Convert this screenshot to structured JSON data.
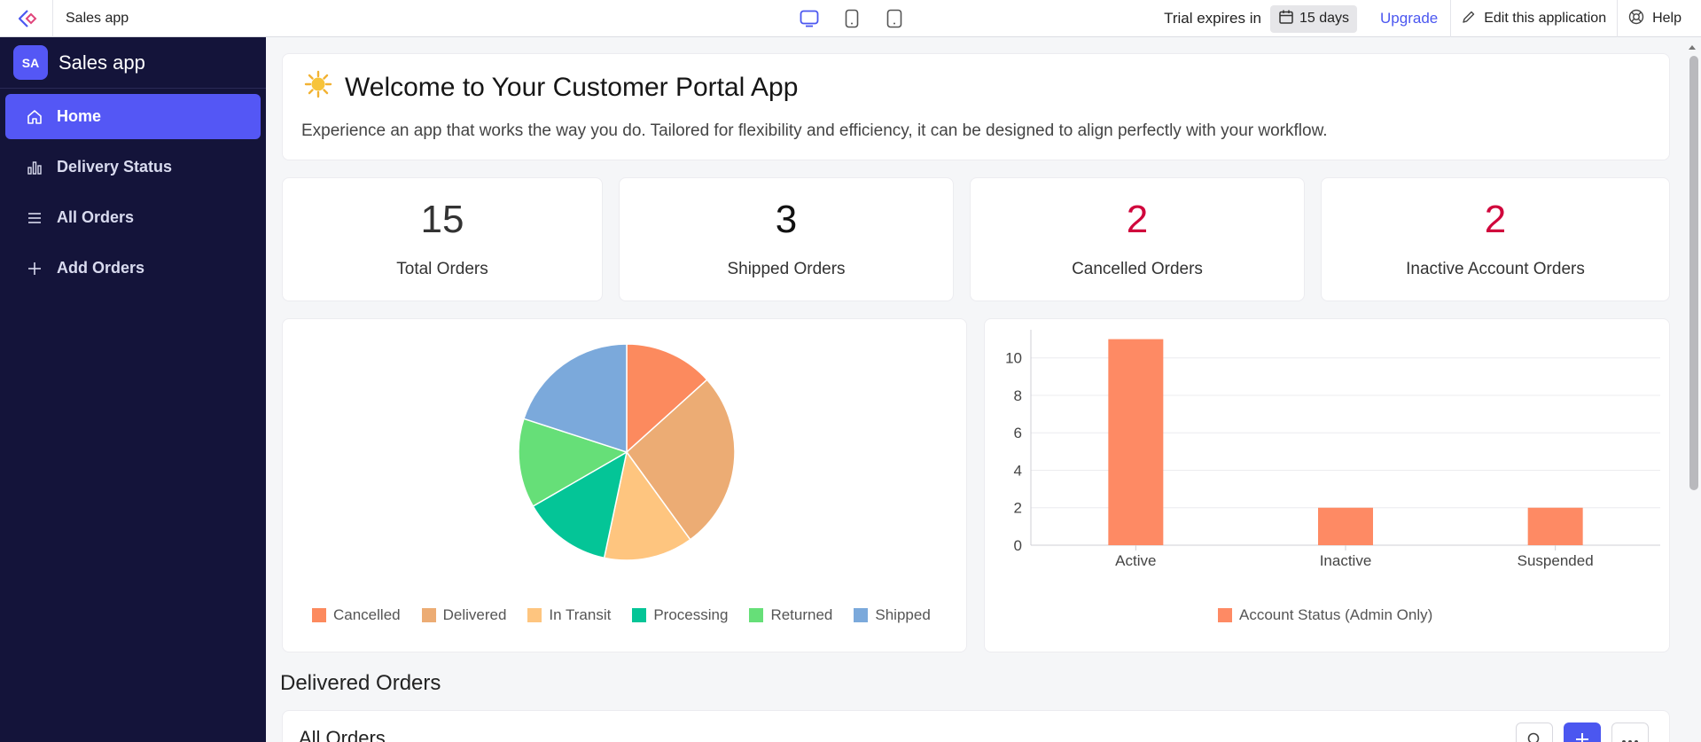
{
  "topbar": {
    "app_name": "Sales app",
    "trial_label": "Trial expires in",
    "trial_days": "15 days",
    "upgrade": "Upgrade",
    "edit_label": "Edit this application",
    "help_label": "Help"
  },
  "sidebar": {
    "avatar": "SA",
    "title": "Sales app",
    "items": [
      {
        "label": "Home",
        "icon": "home-icon",
        "active": true
      },
      {
        "label": "Delivery Status",
        "icon": "bar-chart-icon",
        "active": false
      },
      {
        "label": "All Orders",
        "icon": "list-icon",
        "active": false
      },
      {
        "label": "Add Orders",
        "icon": "plus-icon",
        "active": false
      }
    ]
  },
  "welcome": {
    "title": "Welcome to Your Customer Portal App",
    "description": "Experience an app that works the way you do. Tailored for flexibility and efficiency, it can be designed to align perfectly with your workflow."
  },
  "stats": [
    {
      "value": "15",
      "label": "Total Orders",
      "color": "#333333"
    },
    {
      "value": "3",
      "label": "Shipped Orders",
      "color": "#111111"
    },
    {
      "value": "2",
      "label": "Cancelled Orders",
      "color": "#d0063c"
    },
    {
      "value": "2",
      "label": "Inactive Account Orders",
      "color": "#d0063c"
    }
  ],
  "chart_data": [
    {
      "type": "pie",
      "categories": [
        "Cancelled",
        "Delivered",
        "In Transit",
        "Processing",
        "Returned",
        "Shipped"
      ],
      "values": [
        2,
        4,
        2,
        2,
        2,
        3
      ],
      "colors": [
        "#fc8a5e",
        "#ecac74",
        "#fec57f",
        "#04c597",
        "#66df78",
        "#7ba9db"
      ],
      "legend": "bottom"
    },
    {
      "type": "bar",
      "categories": [
        "Active",
        "Inactive",
        "Suspended"
      ],
      "series": [
        {
          "name": "Account Status (Admin Only)",
          "values": [
            11,
            2,
            2
          ],
          "color": "#fe8a64"
        }
      ],
      "yticks": [
        "0",
        "2",
        "4",
        "6",
        "8",
        "10"
      ],
      "ylim": [
        0,
        11.5
      ],
      "grid": true,
      "legend": "bottom"
    }
  ],
  "sections": {
    "delivered_title": "Delivered Orders",
    "all_orders_title": "All Orders"
  }
}
